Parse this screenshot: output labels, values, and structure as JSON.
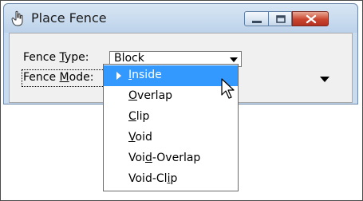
{
  "window": {
    "title": "Place Fence",
    "app_icon": "hand-pointer-icon"
  },
  "fence_type": {
    "label_pre": "Fence ",
    "label_underlined": "T",
    "label_post": "ype:",
    "value": "Block"
  },
  "fence_mode": {
    "label_pre": "Fence ",
    "label_underlined": "M",
    "label_post": "ode:"
  },
  "dropdown": {
    "options": [
      {
        "pre": "",
        "u": "I",
        "post": "nside"
      },
      {
        "pre": "",
        "u": "O",
        "post": "verlap"
      },
      {
        "pre": "",
        "u": "C",
        "post": "lip"
      },
      {
        "pre": "",
        "u": "V",
        "post": "oid"
      },
      {
        "pre": "Voi",
        "u": "d",
        "post": "-Overlap"
      },
      {
        "pre": "Void-Cl",
        "u": "i",
        "post": "p"
      }
    ],
    "selected_index": 0
  },
  "colors": {
    "selection": "#3399ff",
    "close_button": "#c9452f",
    "title_bar": "#c9dcef"
  }
}
